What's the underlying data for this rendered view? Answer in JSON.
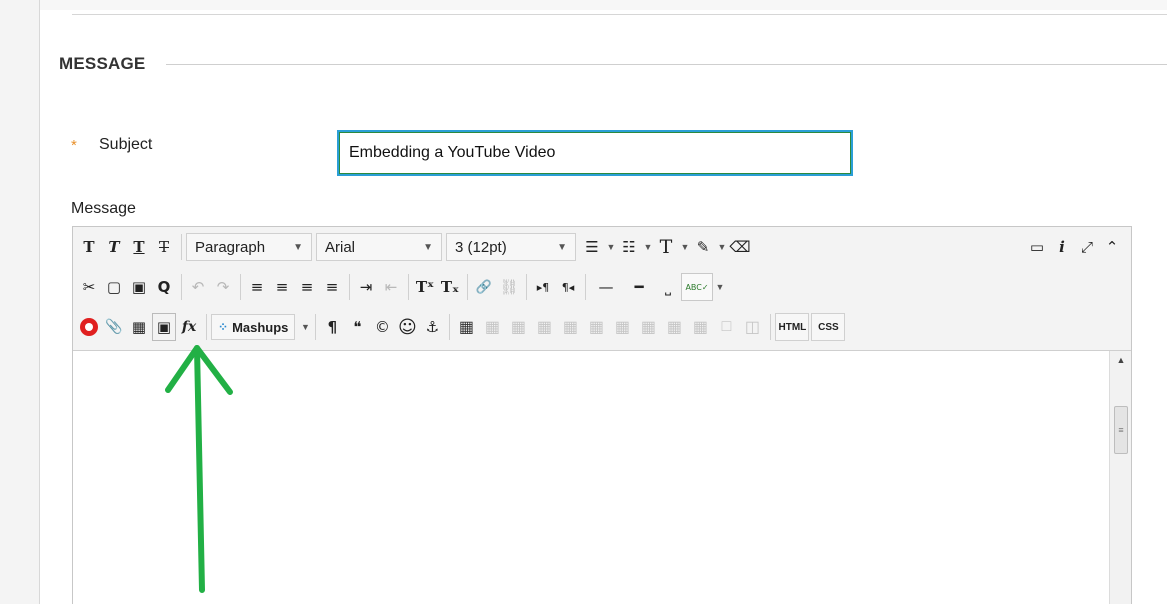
{
  "section": {
    "title": "MESSAGE"
  },
  "subject": {
    "label": "Subject",
    "required_mark": "*",
    "value": "Embedding a YouTube Video"
  },
  "message": {
    "label": "Message"
  },
  "toolbar": {
    "row1": {
      "bold": "T",
      "italic": "T",
      "underline": "T",
      "strike": "T",
      "format_select": "Paragraph",
      "font_select": "Arial",
      "size_select": "3 (12pt)",
      "bullet_list": "☰",
      "numbered_list": "☷",
      "text_color": "T",
      "highlight": "✎",
      "eraser": "⌫",
      "preview": "▭",
      "info": "i",
      "fullscreen": "⤢",
      "collapse": "⌃"
    },
    "row2": {
      "cut": "✂",
      "copy": "▢",
      "paste": "▣",
      "find": "Q",
      "undo": "↶",
      "redo": "↷",
      "align_left": "≡",
      "align_center": "≡",
      "align_right": "≡",
      "align_justify": "≡",
      "indent": "⇥",
      "outdent": "⇤",
      "superscript": "Tˣ",
      "subscript": "Tₓ",
      "link": "🔗",
      "unlink": "⛓",
      "ltr": "▸¶",
      "rtl": "¶◂",
      "hr_thin": "—",
      "hr_thick": "━",
      "nbsp": "⎵",
      "spellcheck": "ABC✓"
    },
    "row3": {
      "youtube": "",
      "attach": "📎",
      "image": "▦",
      "media": "▣",
      "math": "fx",
      "mashups": "Mashups",
      "paragraph_mark": "¶",
      "blockquote": "❝",
      "copyright": "©",
      "emoji": "☺",
      "anchor": "⚓",
      "table": "▦",
      "html": "HTML",
      "css": "CSS"
    }
  },
  "colors": {
    "accent_blue": "#2a9fd6",
    "required_orange": "#e8902a",
    "annotation_green": "#22b045",
    "youtube_red": "#e02020"
  }
}
